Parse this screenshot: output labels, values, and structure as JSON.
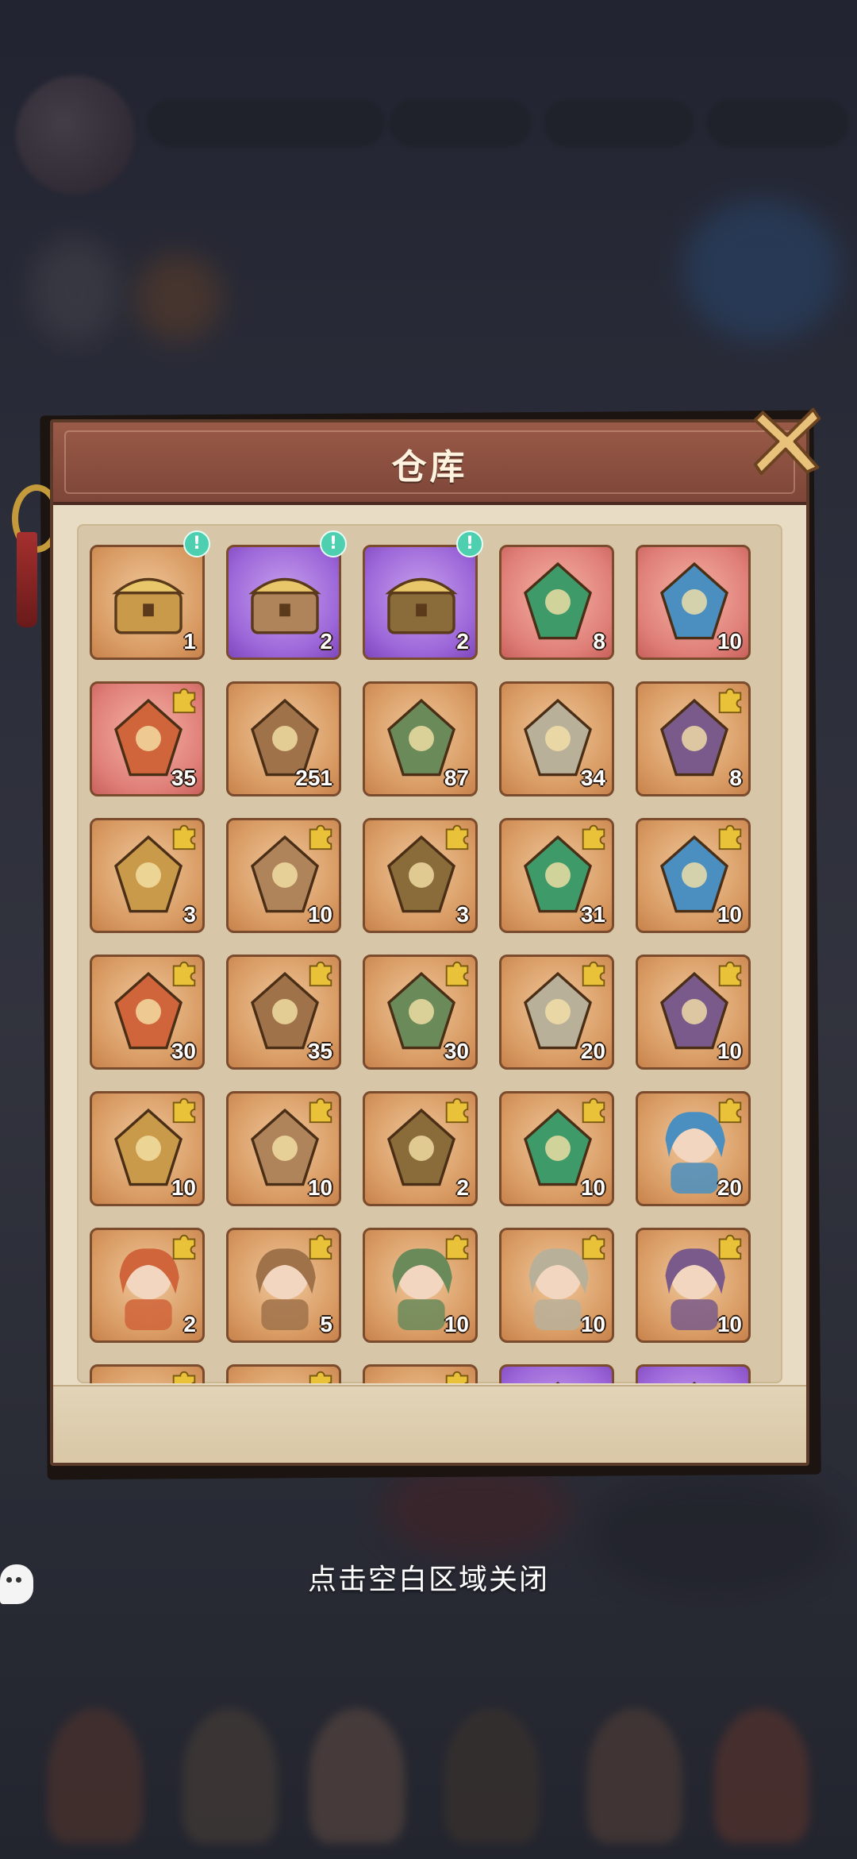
{
  "modal": {
    "title": "仓库",
    "close_hint": "点击空白区域关闭"
  },
  "background": {
    "resources": [
      "",
      "",
      ""
    ]
  },
  "items": [
    {
      "name": "gold-egg-chest",
      "qty": "1",
      "rarity": "orange",
      "notify": true,
      "puzzle": false
    },
    {
      "name": "silver-purple-chest",
      "qty": "2",
      "rarity": "purple",
      "notify": true,
      "puzzle": false
    },
    {
      "name": "purple-cube-chest",
      "qty": "2",
      "rarity": "purple",
      "notify": true,
      "puzzle": false
    },
    {
      "name": "green-swirl-orb",
      "qty": "8",
      "rarity": "red",
      "notify": false,
      "puzzle": false
    },
    {
      "name": "map-scroll",
      "qty": "10",
      "rarity": "red",
      "notify": false,
      "puzzle": false
    },
    {
      "name": "flame-beast-relic",
      "qty": "35",
      "rarity": "red",
      "notify": false,
      "puzzle": true
    },
    {
      "name": "red-token",
      "qty": "251",
      "rarity": "orange",
      "notify": false,
      "puzzle": false
    },
    {
      "name": "bronze-key",
      "qty": "87",
      "rarity": "orange",
      "notify": false,
      "puzzle": false
    },
    {
      "name": "gold-token",
      "qty": "34",
      "rarity": "orange",
      "notify": false,
      "puzzle": false
    },
    {
      "name": "pagoda-tower",
      "qty": "8",
      "rarity": "orange",
      "notify": false,
      "puzzle": true
    },
    {
      "name": "golden-axe",
      "qty": "3",
      "rarity": "orange",
      "notify": false,
      "puzzle": true
    },
    {
      "name": "jade-blade",
      "qty": "10",
      "rarity": "orange",
      "notify": false,
      "puzzle": true
    },
    {
      "name": "blue-orb-amulet",
      "qty": "3",
      "rarity": "orange",
      "notify": false,
      "puzzle": true
    },
    {
      "name": "fire-wheel",
      "qty": "31",
      "rarity": "orange",
      "notify": false,
      "puzzle": true
    },
    {
      "name": "bronze-cauldron",
      "qty": "10",
      "rarity": "orange",
      "notify": false,
      "puzzle": true
    },
    {
      "name": "lightning-sword",
      "qty": "30",
      "rarity": "orange",
      "notify": false,
      "puzzle": true
    },
    {
      "name": "thunder-mask",
      "qty": "35",
      "rarity": "orange",
      "notify": false,
      "puzzle": true
    },
    {
      "name": "silver-compass",
      "qty": "30",
      "rarity": "orange",
      "notify": false,
      "puzzle": true
    },
    {
      "name": "balance-scale",
      "qty": "20",
      "rarity": "orange",
      "notify": false,
      "puzzle": true
    },
    {
      "name": "dragon-crown-plate",
      "qty": "10",
      "rarity": "orange",
      "notify": false,
      "puzzle": true
    },
    {
      "name": "dragon-scarab-plate",
      "qty": "10",
      "rarity": "orange",
      "notify": false,
      "puzzle": true
    },
    {
      "name": "dragon-turtle-plate",
      "qty": "10",
      "rarity": "orange",
      "notify": false,
      "puzzle": true
    },
    {
      "name": "dragon-crystal-plate",
      "qty": "2",
      "rarity": "orange",
      "notify": false,
      "puzzle": true
    },
    {
      "name": "dragon-flame-plate",
      "qty": "10",
      "rarity": "orange",
      "notify": false,
      "puzzle": true
    },
    {
      "name": "hero-portrait-dark-hair",
      "qty": "20",
      "rarity": "orange",
      "notify": false,
      "puzzle": true
    },
    {
      "name": "hero-portrait-silver-girl",
      "qty": "2",
      "rarity": "orange",
      "notify": false,
      "puzzle": true
    },
    {
      "name": "hero-portrait-green-hair",
      "qty": "5",
      "rarity": "orange",
      "notify": false,
      "puzzle": true
    },
    {
      "name": "hero-portrait-dancer",
      "qty": "10",
      "rarity": "orange",
      "notify": false,
      "puzzle": true
    },
    {
      "name": "hero-portrait-white-hair",
      "qty": "10",
      "rarity": "orange",
      "notify": false,
      "puzzle": true
    },
    {
      "name": "hero-portrait-child",
      "qty": "10",
      "rarity": "orange",
      "notify": false,
      "puzzle": true
    },
    {
      "name": "hero-portrait-partial-1",
      "qty": "",
      "rarity": "orange",
      "notify": false,
      "puzzle": true
    },
    {
      "name": "hero-portrait-partial-2",
      "qty": "",
      "rarity": "orange",
      "notify": false,
      "puzzle": true
    },
    {
      "name": "hero-portrait-partial-3",
      "qty": "",
      "rarity": "orange",
      "notify": false,
      "puzzle": true
    },
    {
      "name": "blue-crystal-partial",
      "qty": "",
      "rarity": "purple",
      "notify": false,
      "puzzle": false
    },
    {
      "name": "compass-partial",
      "qty": "",
      "rarity": "purple",
      "notify": false,
      "puzzle": false
    }
  ],
  "colors": {
    "frame": "#5b3a2a",
    "title_band": "#8a4e40",
    "slot_orange": "#d89a62",
    "slot_purple": "#9b65d8",
    "slot_red": "#df7f78",
    "notify": "#4ed0b0",
    "puzzle": "#e9c23a"
  }
}
